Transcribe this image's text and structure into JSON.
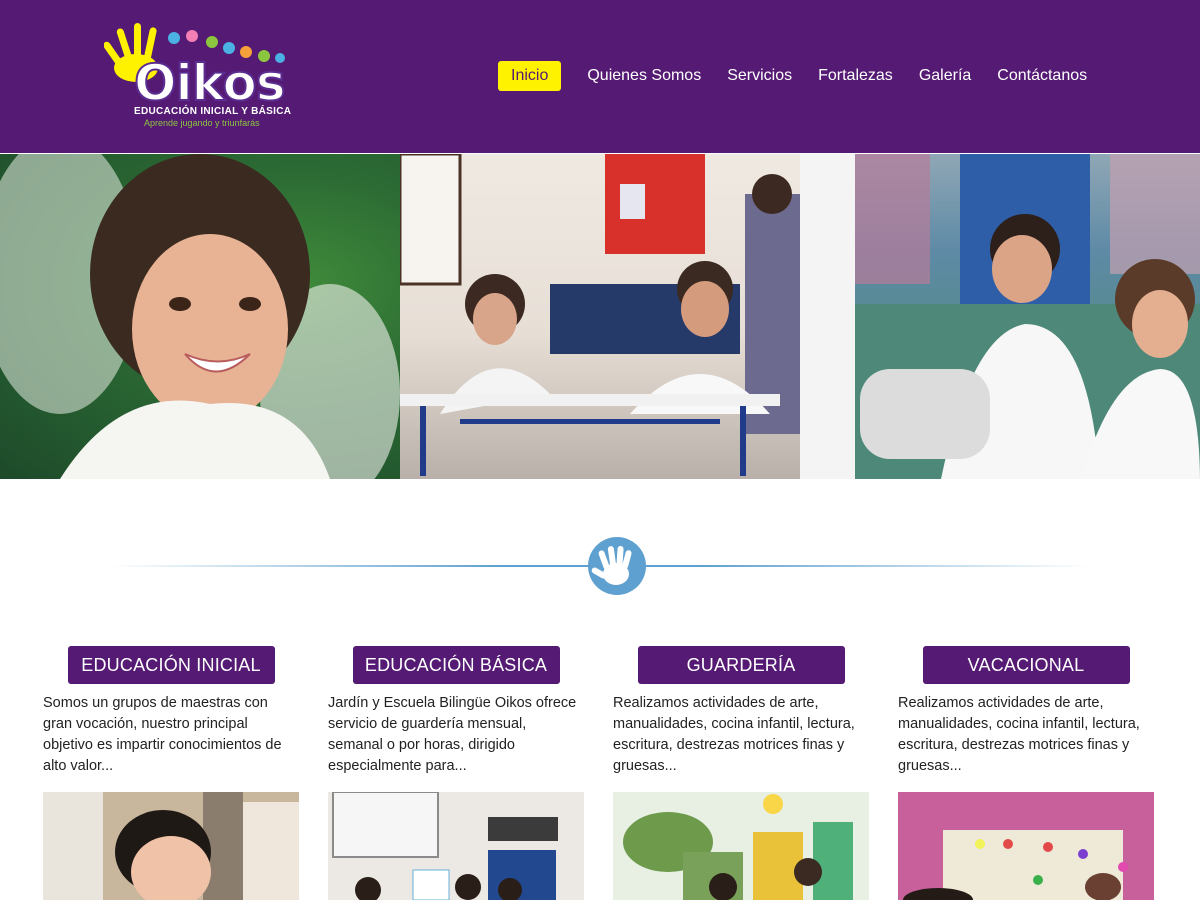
{
  "brand": {
    "name": "Oikos",
    "subtitle": "EDUCACIÓN INICIAL Y BÁSICA",
    "tagline": "Aprende jugando y triunfarás"
  },
  "nav": {
    "items": [
      {
        "label": "Inicio",
        "active": true
      },
      {
        "label": "Quienes Somos",
        "active": false
      },
      {
        "label": "Servicios",
        "active": false
      },
      {
        "label": "Fortalezas",
        "active": false
      },
      {
        "label": "Galería",
        "active": false
      },
      {
        "label": "Contáctanos",
        "active": false
      }
    ]
  },
  "banner": {
    "photos": [
      "smiling-girl-photo",
      "classroom-children-photo",
      "children-sitting-photo"
    ]
  },
  "divider": {
    "icon": "hand-icon"
  },
  "cards": [
    {
      "title": "EDUCACIÓN INICIAL",
      "text": "Somos un grupos de maestras con gran vocación, nuestro principal objetivo es impartir conocimientos de alto valor..."
    },
    {
      "title": "EDUCACIÓN BÁSICA",
      "text": "Jardín y Escuela Bilingüe Oikos ofrece servicio de guardería mensual, semanal o por horas, dirigido especialmente para..."
    },
    {
      "title": "GUARDERÍA",
      "text": "Realizamos actividades de arte, manualidades, cocina infantil, lectura, escritura, destrezas motrices finas y gruesas..."
    },
    {
      "title": "VACACIONAL",
      "text": "Realizamos actividades de arte, manualidades, cocina infantil, lectura, escritura, destrezas motrices finas y gruesas..."
    }
  ],
  "colors": {
    "header_bg": "#551a73",
    "active_nav_bg": "#fff200",
    "accent_blue": "#5ea0cf",
    "logo_yellow": "#fff200",
    "tagline_green": "#8cc63f"
  }
}
